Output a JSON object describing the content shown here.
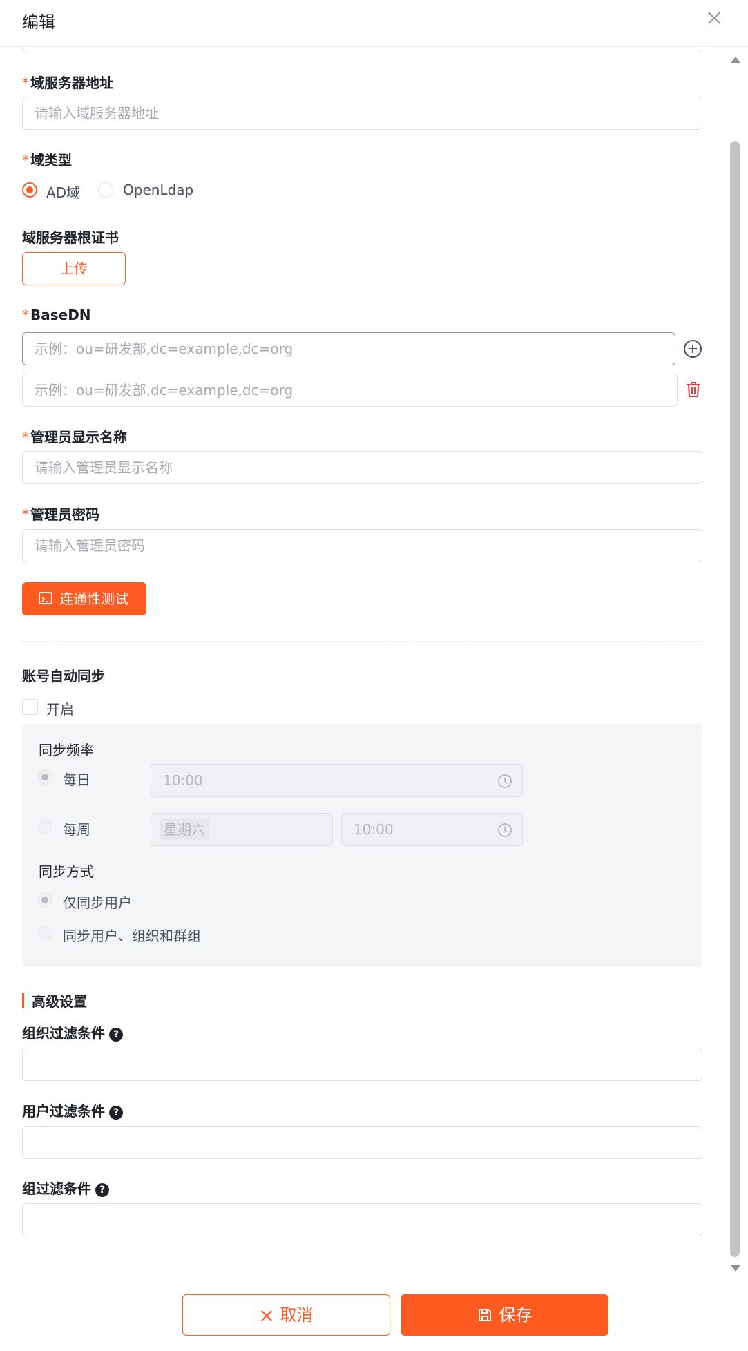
{
  "header": {
    "title": "编辑",
    "close_icon": "close-icon"
  },
  "form": {
    "domain_server_address": {
      "label": "域服务器地址",
      "placeholder": "请输入域服务器地址",
      "required": true
    },
    "domain_type": {
      "label": "域类型",
      "required": true,
      "options": [
        "AD域",
        "OpenLdap"
      ],
      "selected": "AD域"
    },
    "root_cert": {
      "label": "域服务器根证书",
      "upload_label": "上传"
    },
    "base_dn": {
      "label": "BaseDN",
      "required": true,
      "placeholders": [
        "示例：ou=研发部,dc=example,dc=org",
        "示例：ou=研发部,dc=example,dc=org"
      ]
    },
    "admin_display_name": {
      "label": "管理员显示名称",
      "placeholder": "请输入管理员显示名称",
      "required": true
    },
    "admin_password": {
      "label": "管理员密码",
      "placeholder": "请输入管理员密码",
      "required": true
    },
    "test_button": "连通性测试",
    "required_mark": "*"
  },
  "auto_sync": {
    "label": "账号自动同步",
    "enable_label": "开启",
    "enabled": false,
    "frequency": {
      "label": "同步频率",
      "daily_label": "每日",
      "daily_time": "10:00",
      "weekly_label": "每周",
      "weekly_day": "星期六",
      "weekly_time": "10:00",
      "selected": "每日"
    },
    "mode": {
      "label": "同步方式",
      "options": [
        "仅同步用户",
        "同步用户、组织和群组"
      ],
      "selected": "仅同步用户"
    }
  },
  "advanced": {
    "title": "高级设置",
    "org_filter": {
      "label": "组织过滤条件",
      "value": ""
    },
    "user_filter": {
      "label": "用户过滤条件",
      "value": ""
    },
    "group_filter": {
      "label": "组过滤条件",
      "value": ""
    },
    "help_glyph": "?"
  },
  "footer": {
    "cancel_label": "取消",
    "save_label": "保存"
  },
  "colors": {
    "accent": "#ff5a1f",
    "danger": "#e53935",
    "border": "#dcdfe6",
    "panel": "#f4f5f7"
  }
}
